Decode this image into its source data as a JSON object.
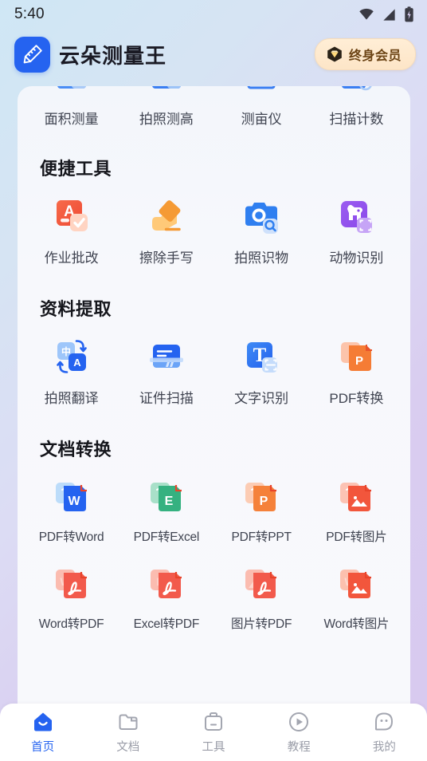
{
  "status_bar": {
    "time": "5:40",
    "icons": [
      "wifi-icon",
      "cellular-signal-icon",
      "battery-charging-icon"
    ]
  },
  "header": {
    "logo_icon": "ruler-pencil-logo-icon",
    "app_title": "云朵测量王",
    "vip_button": {
      "icon": "diamond-gem-icon",
      "label": "终身会员"
    }
  },
  "partial_row": {
    "items": [
      {
        "label": "面积测量",
        "icon": "area-measure-icon"
      },
      {
        "label": "拍照测高",
        "icon": "photo-height-icon"
      },
      {
        "label": "测亩仪",
        "icon": "land-area-icon"
      },
      {
        "label": "扫描计数",
        "icon": "scan-count-icon"
      }
    ]
  },
  "sections": [
    {
      "title": "便捷工具",
      "items": [
        {
          "label": "作业批改",
          "icon": "homework-correction-icon"
        },
        {
          "label": "擦除手写",
          "icon": "eraser-icon"
        },
        {
          "label": "拍照识物",
          "icon": "camera-recognize-icon"
        },
        {
          "label": "动物识别",
          "icon": "animal-recognize-icon"
        }
      ]
    },
    {
      "title": "资料提取",
      "items": [
        {
          "label": "拍照翻译",
          "icon": "photo-translate-icon"
        },
        {
          "label": "证件扫描",
          "icon": "id-card-scan-icon"
        },
        {
          "label": "文字识别",
          "icon": "text-ocr-icon"
        },
        {
          "label": "PDF转换",
          "icon": "pdf-convert-icon"
        }
      ]
    },
    {
      "title": "文档转换",
      "items": [
        {
          "label": "PDF转Word",
          "icon": "pdf-to-word-icon"
        },
        {
          "label": "PDF转Excel",
          "icon": "pdf-to-excel-icon"
        },
        {
          "label": "PDF转PPT",
          "icon": "pdf-to-ppt-icon"
        },
        {
          "label": "PDF转图片",
          "icon": "pdf-to-image-icon"
        },
        {
          "label": "Word转PDF",
          "icon": "word-to-pdf-icon"
        },
        {
          "label": "Excel转PDF",
          "icon": "excel-to-pdf-icon"
        },
        {
          "label": "图片转PDF",
          "icon": "image-to-pdf-icon"
        },
        {
          "label": "Word转图片",
          "icon": "word-to-image-icon"
        }
      ]
    }
  ],
  "tabbar": {
    "active_index": 0,
    "tabs": [
      {
        "label": "首页",
        "icon": "home-icon"
      },
      {
        "label": "文档",
        "icon": "folder-icon"
      },
      {
        "label": "工具",
        "icon": "toolbox-icon"
      },
      {
        "label": "教程",
        "icon": "play-circle-icon"
      },
      {
        "label": "我的",
        "icon": "profile-smiley-icon"
      }
    ]
  },
  "colors": {
    "accent": "#2563f0",
    "vip_text": "#6b4314",
    "label_text": "#3f4350",
    "inactive_tab": "#9a9da8"
  }
}
